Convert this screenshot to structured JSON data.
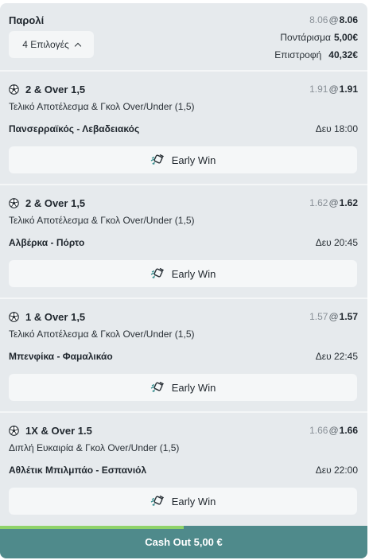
{
  "header": {
    "title": "Παρολί",
    "old_odds": "8.06",
    "at": "@",
    "new_odds": "8.06",
    "selections_label": "4 Επιλογές",
    "stake_label": "Ποντάρισμα",
    "stake_value": "5,00€",
    "return_label": "Επιστροφή",
    "return_value": "40,32€"
  },
  "legs": [
    {
      "title": "2 & Over 1,5",
      "old_odds": "1.91",
      "new_odds": "1.91",
      "market": "Τελικό Αποτέλεσμα & Γκολ Over/Under (1,5)",
      "match": "Πανσερραϊκός - Λεβαδειακός",
      "time": "Δευ 18:00",
      "early_win": "Early Win"
    },
    {
      "title": "2 & Over 1,5",
      "old_odds": "1.62",
      "new_odds": "1.62",
      "market": "Τελικό Αποτέλεσμα & Γκολ Over/Under (1,5)",
      "match": "Αλβέρκα - Πόρτο",
      "time": "Δευ 20:45",
      "early_win": "Early Win"
    },
    {
      "title": "1 & Over 1,5",
      "old_odds": "1.57",
      "new_odds": "1.57",
      "market": "Τελικό Αποτέλεσμα & Γκολ Over/Under (1,5)",
      "match": "Μπενφίκα - Φαμαλικάο",
      "time": "Δευ 22:45",
      "early_win": "Early Win"
    },
    {
      "title": "1X & Over 1.5",
      "old_odds": "1.66",
      "new_odds": "1.66",
      "market": "Διπλή Ευκαιρία & Γκολ Over/Under (1,5)",
      "match": "Αθλέτικ Μπιλμπάο - Εσπανιόλ",
      "time": "Δευ 22:00",
      "early_win": "Early Win"
    }
  ],
  "cashout": {
    "label": "Cash Out 5,00 €",
    "progress": 0.5
  },
  "icons": {
    "leg_icon": "soccer-ball-icon",
    "early_win_icon": "early-win-icon"
  },
  "colors": {
    "cashout_bg": "#4f8a8b",
    "progress": "#8fd36a"
  }
}
